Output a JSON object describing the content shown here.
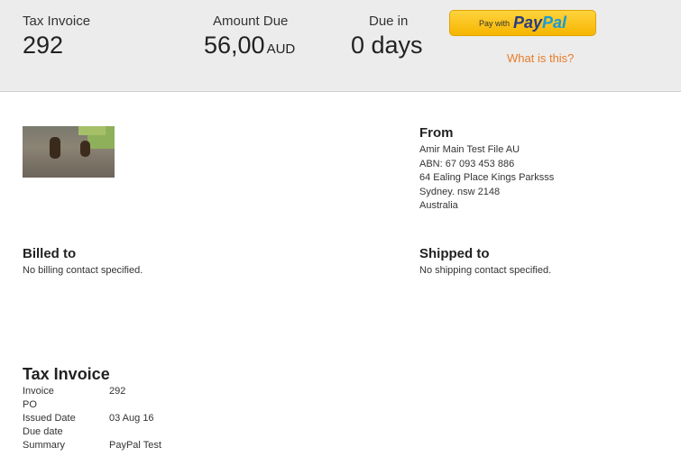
{
  "header": {
    "tax_invoice_label": "Tax Invoice",
    "tax_invoice_number": "292",
    "amount_due_label": "Amount Due",
    "amount_due_value": "56,00",
    "amount_due_currency": "AUD",
    "due_in_label": "Due in",
    "due_in_value": "0 days",
    "paypal_pay_with": "Pay with",
    "paypal_brand_1": "Pay",
    "paypal_brand_2": "Pal",
    "what_is_this": "What is this?"
  },
  "from": {
    "title": "From",
    "lines": [
      "Amir Main Test File AU",
      "ABN: 67 093 453 886",
      "64 Ealing Place Kings Parksss",
      "Sydney. nsw 2148",
      "Australia"
    ]
  },
  "billed": {
    "title": "Billed to",
    "text": "No billing contact specified."
  },
  "shipped": {
    "title": "Shipped to",
    "text": "No shipping contact specified."
  },
  "invoice": {
    "title": "Tax Invoice",
    "rows": [
      {
        "label": "Invoice",
        "value": "292"
      },
      {
        "label": "PO",
        "value": ""
      },
      {
        "label": "Issued Date",
        "value": "03 Aug 16"
      },
      {
        "label": "Due date",
        "value": ""
      },
      {
        "label": "Summary",
        "value": "PayPal Test"
      }
    ]
  }
}
